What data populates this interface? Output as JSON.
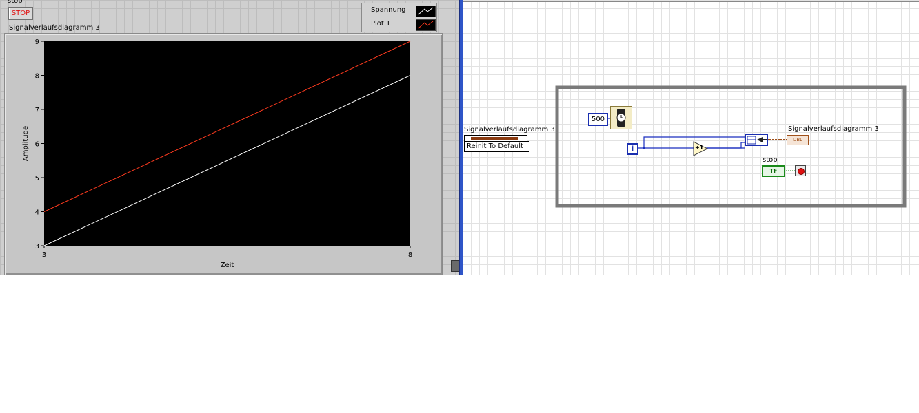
{
  "front_panel": {
    "stop_label": "stop",
    "stop_button": "STOP",
    "chart_label": "Signalverlaufsdiagramm 3",
    "legend": [
      {
        "name": "Spannung",
        "color": "#ffffff"
      },
      {
        "name": "Plot 1",
        "color": "#ff3b1f"
      }
    ]
  },
  "chart_data": {
    "type": "line",
    "xlabel": "Zeit",
    "ylabel": "Amplitude",
    "xlim": [
      3,
      8
    ],
    "ylim": [
      3,
      9
    ],
    "x_ticks": [
      "3",
      "8"
    ],
    "y_ticks": [
      "3",
      "4",
      "5",
      "6",
      "7",
      "8",
      "9"
    ],
    "series": [
      {
        "name": "Spannung",
        "x": [
          3,
          8
        ],
        "values": [
          3,
          8
        ],
        "color": "#ffffff"
      },
      {
        "name": "Plot 1",
        "x": [
          3,
          8
        ],
        "values": [
          4,
          9
        ],
        "color": "#ff3b1f"
      }
    ]
  },
  "block_diagram": {
    "chart_label": "Signalverlaufsdiagramm 3",
    "chart_terminal_label": "Signalverlaufsdiagramm 3",
    "reinit_label": "Reinit To Default",
    "wait_constant": "500",
    "iteration_label": "i",
    "increment_label": "+1",
    "stop_label": "stop",
    "tf_label": "TF",
    "chart_term_text": "DBL"
  }
}
